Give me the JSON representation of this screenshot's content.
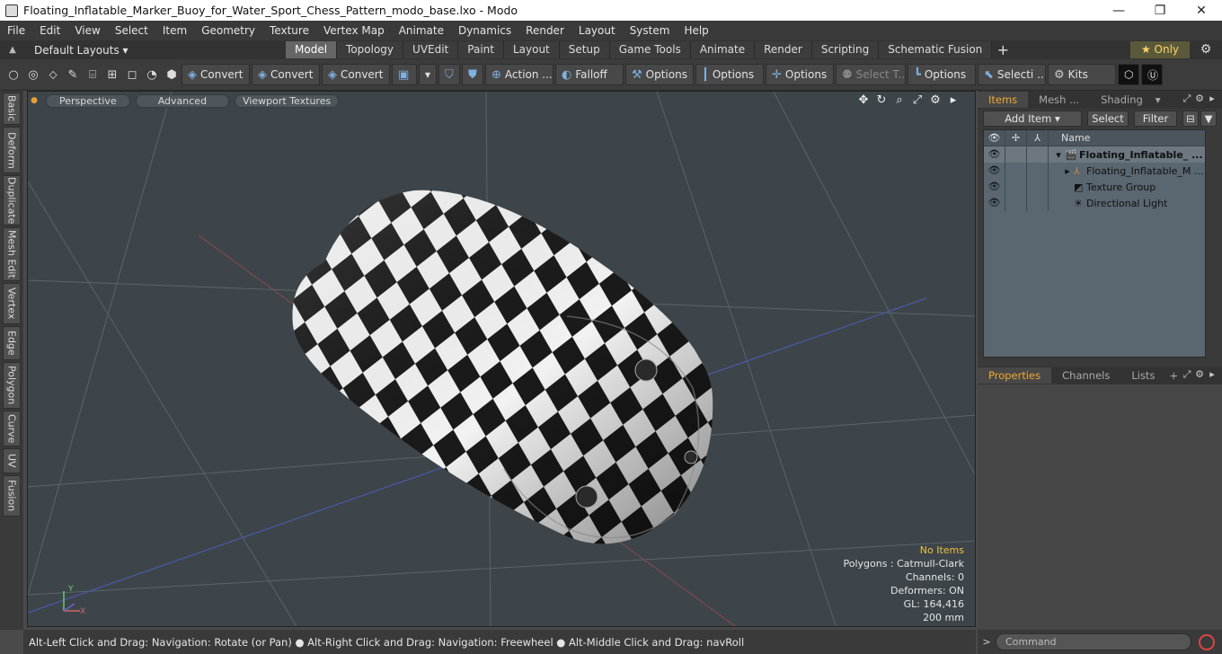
{
  "window": {
    "title": "Floating_Inflatable_Marker_Buoy_for_Water_Sport_Chess_Pattern_modo_base.lxo - Modo",
    "minimize": "—",
    "maximize": "❐",
    "close": "✕"
  },
  "menu": [
    "File",
    "Edit",
    "View",
    "Select",
    "Item",
    "Geometry",
    "Texture",
    "Vertex Map",
    "Animate",
    "Dynamics",
    "Render",
    "Layout",
    "System",
    "Help"
  ],
  "layoutbar": {
    "layout_select": "Default Layouts ▾",
    "tabs": [
      "Model",
      "Topology",
      "UVEdit",
      "Paint",
      "Layout",
      "Setup",
      "Game Tools",
      "Animate",
      "Render",
      "Scripting",
      "Schematic Fusion"
    ],
    "active_tab": "Model",
    "only_label": "★  Only"
  },
  "toolbar": {
    "convert1": "Convert",
    "convert2": "Convert",
    "convert3": "Convert",
    "action": "Action ...",
    "falloff": "Falloff",
    "options1": "Options",
    "options2": "Options",
    "options3": "Options",
    "select_t": "Select T...",
    "options4": "Options",
    "selecti": "Selecti ...",
    "kits": "Kits"
  },
  "left_tabs": [
    "Basic",
    "Deform",
    "Duplicate",
    "Mesh Edit",
    "Vertex",
    "Edge",
    "Polygon",
    "Curve",
    "UV",
    "Fusion"
  ],
  "viewport": {
    "perspective": "Perspective",
    "advanced": "Advanced",
    "textures": "Viewport Textures",
    "stats": {
      "no_items": "No Items",
      "polygons": "Polygons : Catmull-Clark",
      "channels": "Channels: 0",
      "deformers": "Deformers: ON",
      "gl": "GL: 164,416",
      "scale": "200 mm"
    }
  },
  "items_panel": {
    "tabs": [
      "Items",
      "Mesh ...",
      "Shading"
    ],
    "add_item": "Add Item",
    "select": "Select",
    "filter": "Filter",
    "col_name": "Name",
    "rows": [
      {
        "name": "Floating_Inflatable_ ...",
        "icon": "scene-icon"
      },
      {
        "name": "Floating_Inflatable_M ...",
        "icon": "mesh-icon"
      },
      {
        "name": "Texture Group",
        "icon": "texture-group-icon"
      },
      {
        "name": "Directional Light",
        "icon": "light-icon"
      }
    ]
  },
  "props_panel": {
    "tabs": [
      "Properties",
      "Channels",
      "Lists"
    ]
  },
  "statusbar": {
    "text": "Alt-Left Click and Drag: Navigation: Rotate (or Pan) ● Alt-Right Click and Drag: Navigation: Freewheel ● Alt-Middle Click and Drag: navRoll"
  },
  "command": {
    "placeholder": "Command"
  }
}
